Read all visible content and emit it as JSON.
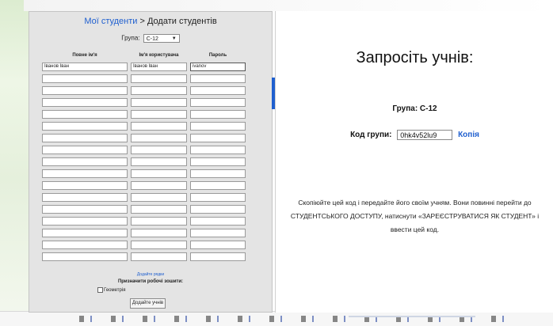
{
  "left": {
    "breadcrumb_link": "Мої студенти",
    "breadcrumb_rest": " > Додати студентів",
    "group_label": "Група:",
    "group_value": "C-12",
    "col_full_name": "Повне ім'я",
    "col_username": "Ім'я користувача",
    "col_password": "Пароль",
    "first_row": {
      "full_name": "Іванов Іван",
      "username": "Іванов Іван",
      "password": "ivanov"
    },
    "add_rows": "Додайте рядки",
    "assign_title": "Призначити робочі зошити:",
    "option_label": "Геометрія",
    "submit_label": "Додайте учнів"
  },
  "right": {
    "title": "Запросіть учнів:",
    "group_text": "Група: C-12",
    "code_label": "Код групи:",
    "code_value": "0hk4v52lu9",
    "copy_label": "Копія",
    "instructions_1": "Скопіюйте цей код і передайте його своїм учням. Вони повинні перейти до",
    "instructions_2": "СТУДЕНТСЬКОГО ДОСТУПУ, натиснути «ЗАРЕЄСТРУВАТИСЯ ЯК СТУДЕНТ» і",
    "instructions_3": "ввести цей код."
  }
}
